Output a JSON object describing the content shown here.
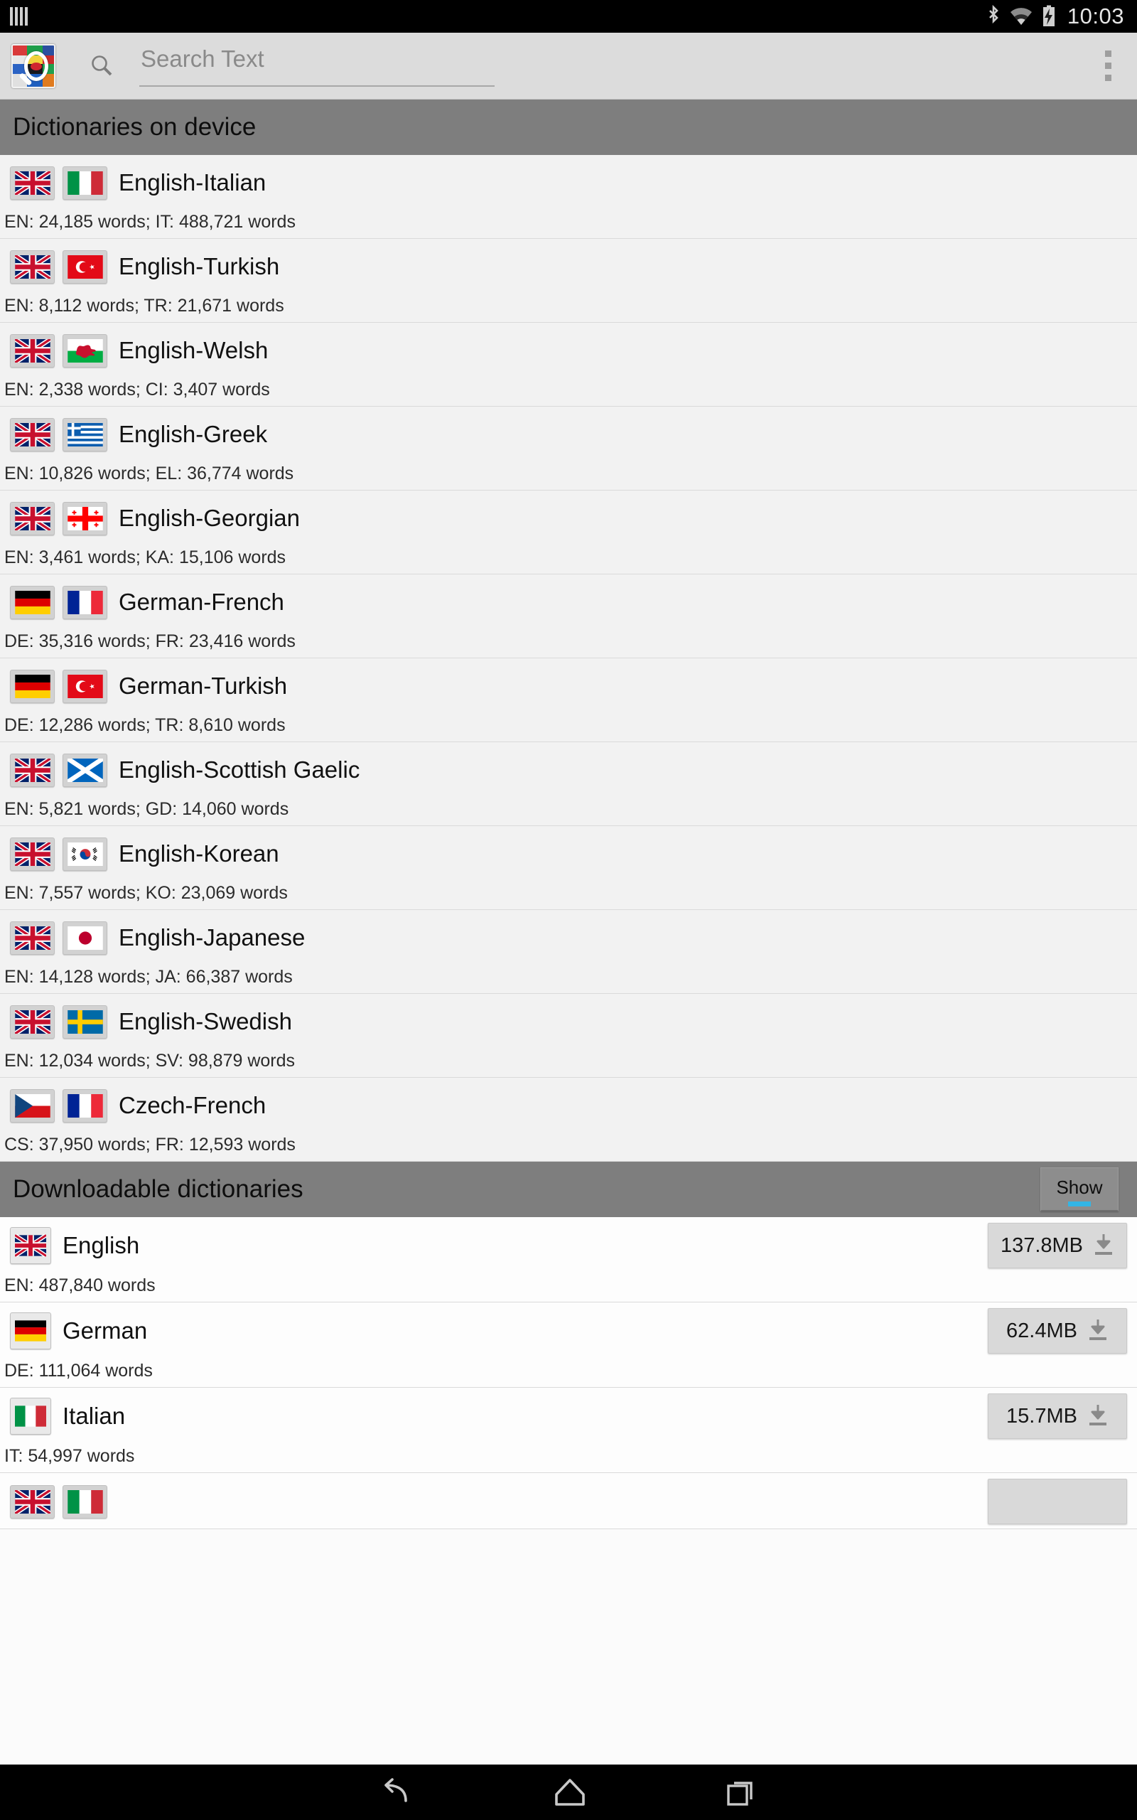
{
  "statusbar": {
    "signal_icon": "signal-bars-icon",
    "bluetooth_icon": "bluetooth-icon",
    "wifi_icon": "wifi-icon",
    "battery_icon": "battery-charging-icon",
    "clock": "10:03"
  },
  "actionbar": {
    "app_icon": "app-flags-search-icon",
    "search_icon": "search-icon",
    "search_placeholder": "Search Text",
    "search_value": "",
    "overflow_icon": "overflow-menu-icon"
  },
  "sections": {
    "on_device": {
      "title": "Dictionaries on device"
    },
    "downloadable": {
      "title": "Downloadable dictionaries",
      "show_label": "Show",
      "accent_color": "#33b5e5"
    }
  },
  "installed": [
    {
      "name": "English-Italian",
      "stats": "EN: 24,185 words; IT: 488,721 words",
      "flag_a": "gb",
      "flag_b": "it"
    },
    {
      "name": "English-Turkish",
      "stats": "EN: 8,112 words; TR: 21,671 words",
      "flag_a": "gb",
      "flag_b": "tr"
    },
    {
      "name": "English-Welsh",
      "stats": "EN: 2,338 words; CI: 3,407 words",
      "flag_a": "gb",
      "flag_b": "wales"
    },
    {
      "name": "English-Greek",
      "stats": "EN: 10,826 words; EL: 36,774 words",
      "flag_a": "gb",
      "flag_b": "gr"
    },
    {
      "name": "English-Georgian",
      "stats": "EN: 3,461 words; KA: 15,106 words",
      "flag_a": "gb",
      "flag_b": "ge"
    },
    {
      "name": "German-French",
      "stats": "DE: 35,316 words; FR: 23,416 words",
      "flag_a": "de",
      "flag_b": "fr"
    },
    {
      "name": "German-Turkish",
      "stats": "DE: 12,286 words; TR: 8,610 words",
      "flag_a": "de",
      "flag_b": "tr"
    },
    {
      "name": "English-Scottish Gaelic",
      "stats": "EN: 5,821 words; GD: 14,060 words",
      "flag_a": "gb",
      "flag_b": "scot"
    },
    {
      "name": "English-Korean",
      "stats": "EN: 7,557 words; KO: 23,069 words",
      "flag_a": "gb",
      "flag_b": "kr"
    },
    {
      "name": "English-Japanese",
      "stats": "EN: 14,128 words; JA: 66,387 words",
      "flag_a": "gb",
      "flag_b": "jp"
    },
    {
      "name": "English-Swedish",
      "stats": "EN: 12,034 words; SV: 98,879 words",
      "flag_a": "gb",
      "flag_b": "se"
    },
    {
      "name": "Czech-French",
      "stats": "CS: 37,950 words; FR: 12,593 words",
      "flag_a": "cz",
      "flag_b": "fr"
    }
  ],
  "downloadable": [
    {
      "name": "English",
      "stats": "EN: 487,840 words",
      "size": "137.8MB",
      "flag_a": "gb",
      "download_icon": "download-icon"
    },
    {
      "name": "German",
      "stats": "DE: 111,064 words",
      "size": "62.4MB",
      "flag_a": "de",
      "download_icon": "download-icon"
    },
    {
      "name": "Italian",
      "stats": "IT: 54,997 words",
      "size": "15.7MB",
      "flag_a": "it",
      "download_icon": "download-icon"
    }
  ],
  "navbar": {
    "back_icon": "back-icon",
    "home_icon": "home-icon",
    "recents_icon": "recents-icon"
  }
}
